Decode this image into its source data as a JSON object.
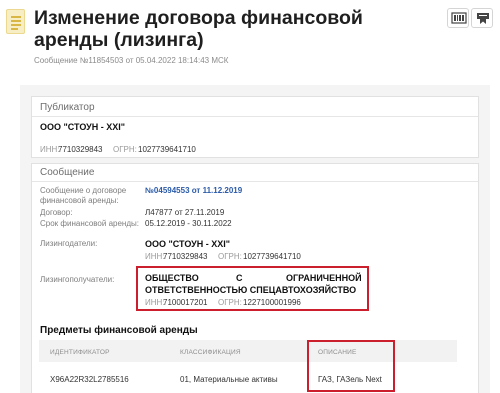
{
  "header": {
    "title": "Изменение договора финансовой аренды (лизинга)",
    "subtitle": "Сообщение №11854503 от 05.04.2022 18:14:43 МСК"
  },
  "toolbar": {
    "icons": [
      "code-icon",
      "bookmark-icon"
    ]
  },
  "publisher": {
    "heading": "Публикатор",
    "name": "ООО \"СТОУН - XXI\"",
    "inn_label": "ИНН:",
    "inn": "7710329843",
    "ogrn_label": "ОГРН:",
    "ogrn": "1027739641710"
  },
  "message": {
    "heading": "Сообщение",
    "contract_msg_label": "Сообщение о договоре финансовой аренды:",
    "contract_msg_link": "№04594553 от 11.12.2019",
    "contract_label": "Договор:",
    "contract_value": "Л47877 от 27.11.2019",
    "term_label": "Срок финансовой аренды:",
    "term_value": "05.12.2019 - 30.11.2022",
    "lessors_label": "Лизингодатели:",
    "lessor": {
      "name": "ООО \"СТОУН - XXI\"",
      "inn_label": "ИНН:",
      "inn": "7710329843",
      "ogrn_label": "ОГРН:",
      "ogrn": "1027739641710"
    },
    "lessees_label": "Лизингополучатели:",
    "lessee": {
      "name_line1": [
        "ОБЩЕСТВО",
        "С",
        "ОГРАНИЧЕННОЙ"
      ],
      "name_line2": "ОТВЕТСТВЕННОСТЬЮ СПЕЦАВТОХОЗЯЙСТВО",
      "inn_label": "ИНН:",
      "inn": "7100017201",
      "ogrn_label": "ОГРН:",
      "ogrn": "1227100001996"
    }
  },
  "subjects": {
    "heading": "Предметы финансовой аренды",
    "columns": [
      "ИДЕНТИФИКАТОР",
      "КЛАССИФИКАЦИЯ",
      "ОПИСАНИЕ"
    ],
    "rows": [
      [
        "X96A22R32L2785516",
        "01, Материальные активы",
        "ГАЗ, ГАЗель Next"
      ]
    ]
  },
  "highlight_color": "#cc1f2d",
  "link_color": "#2a5aa8"
}
